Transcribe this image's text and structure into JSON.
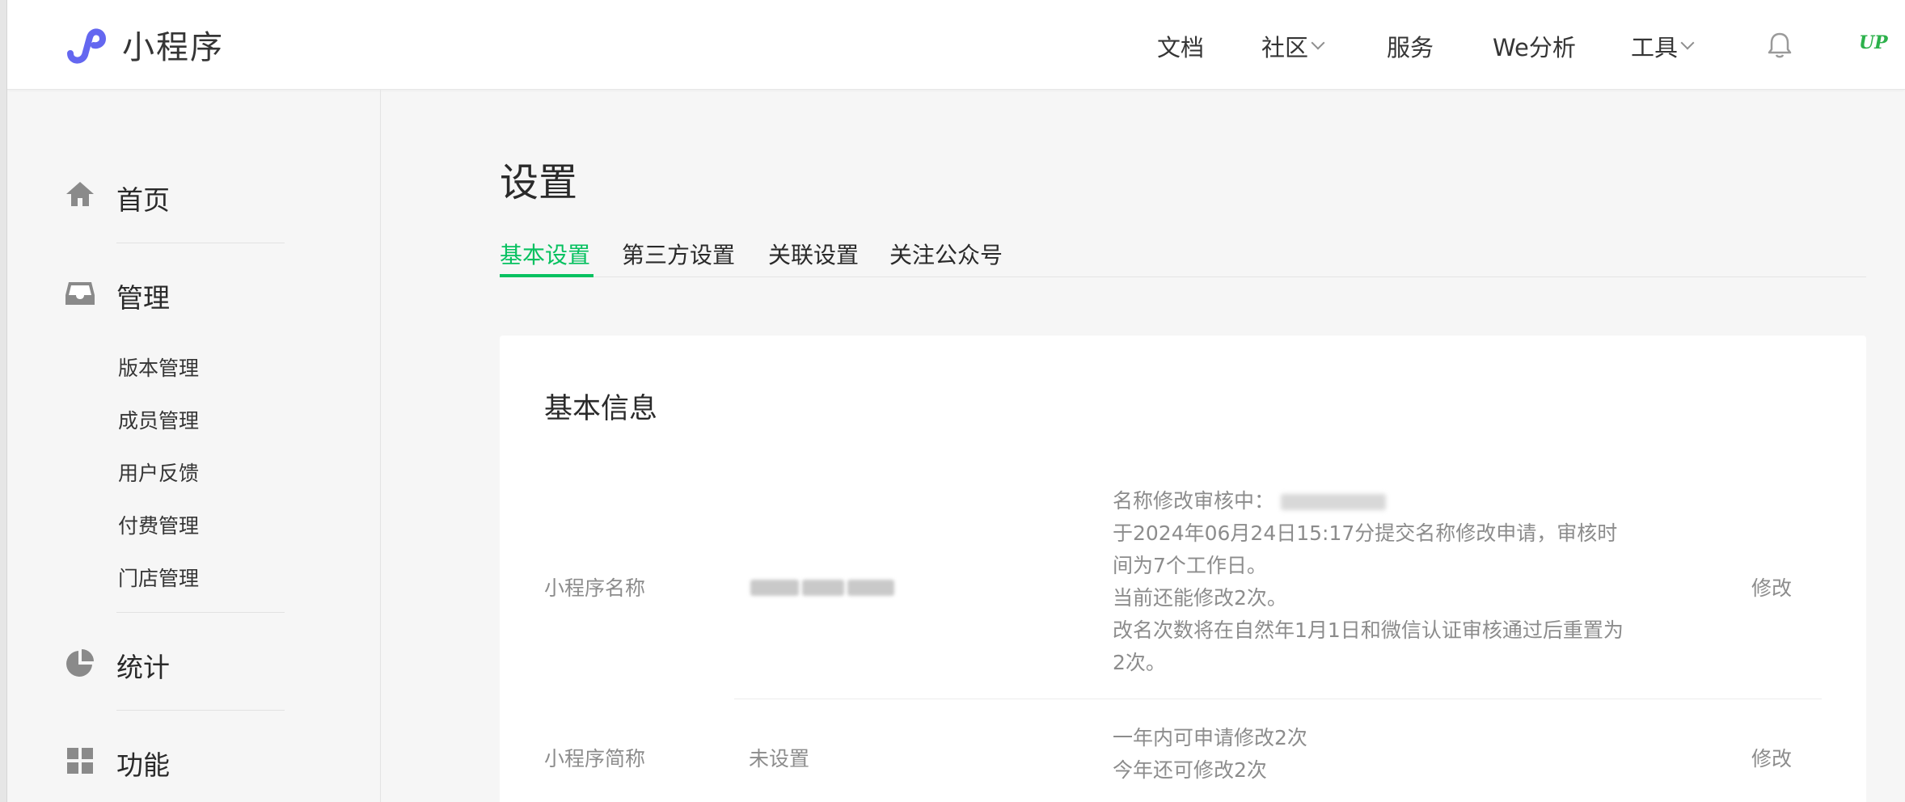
{
  "header": {
    "brand": "小程序",
    "nav": [
      {
        "label": "文档",
        "has_dropdown": false
      },
      {
        "label": "社区",
        "has_dropdown": true
      },
      {
        "label": "服务",
        "has_dropdown": false
      },
      {
        "label": "We分析",
        "has_dropdown": false
      },
      {
        "label": "工具",
        "has_dropdown": true
      }
    ],
    "bell_icon": "bell-icon",
    "avatar_text": "UP"
  },
  "sidebar": {
    "home": {
      "label": "首页",
      "icon": "home-icon"
    },
    "manage": {
      "label": "管理",
      "icon": "inbox-icon",
      "items": [
        "版本管理",
        "成员管理",
        "用户反馈",
        "付费管理",
        "门店管理"
      ]
    },
    "stats": {
      "label": "统计",
      "icon": "pie-chart-icon"
    },
    "features": {
      "label": "功能",
      "icon": "grid-icon"
    }
  },
  "main": {
    "title": "设置",
    "tabs": [
      "基本设置",
      "第三方设置",
      "关联设置",
      "关注公众号"
    ],
    "active_tab": 0,
    "card_title": "基本信息",
    "rows": [
      {
        "label": "小程序名称",
        "value": "",
        "desc": [
          "名称修改审核中：",
          "于2024年06月24日15:17分提交名称修改申请，审核时",
          "间为7个工作日。",
          "当前还能修改2次。",
          "改名次数将在自然年1月1日和微信认证审核通过后重置为",
          "2次。"
        ],
        "action": "修改"
      },
      {
        "label": "小程序简称",
        "value": "未设置",
        "desc": [
          "一年内可申请修改2次",
          "今年还可修改2次"
        ],
        "action": "修改"
      }
    ]
  },
  "colors": {
    "accent": "#07c160",
    "brand_logo": "#6467f0"
  }
}
